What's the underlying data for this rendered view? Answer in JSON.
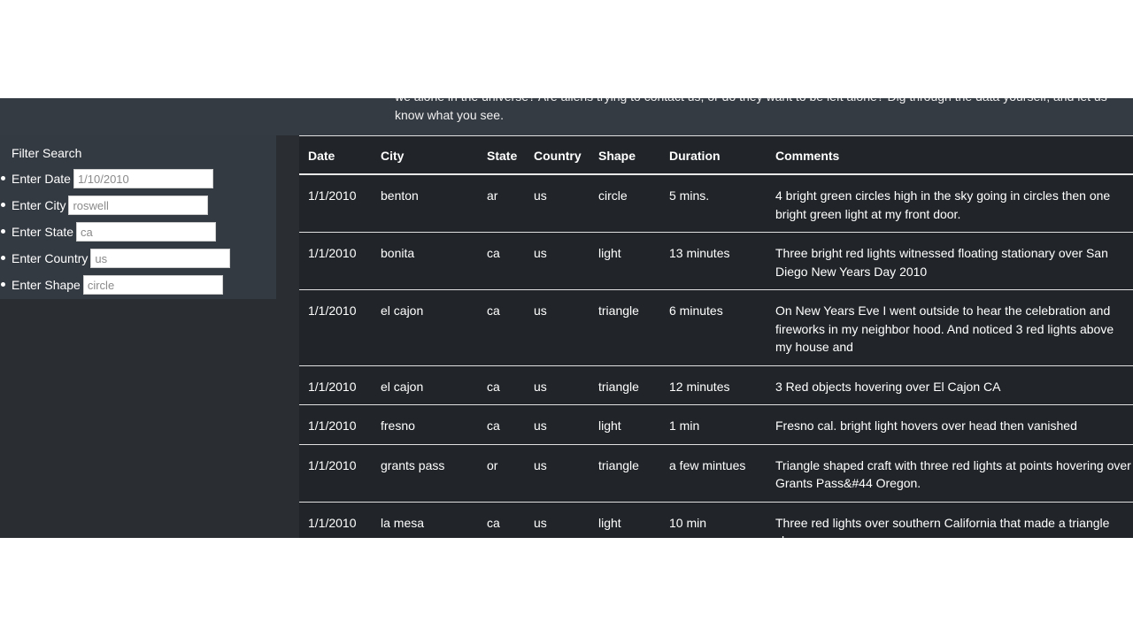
{
  "intro": {
    "text": "we alone in the universe? Are aliens trying to contact us, or do they want to be left alone? Dig through the data yourself, and let us know what you see."
  },
  "filter": {
    "title": "Filter Search",
    "fields": [
      {
        "label": "Enter Date",
        "placeholder": "1/10/2010"
      },
      {
        "label": "Enter City",
        "placeholder": "roswell"
      },
      {
        "label": "Enter State",
        "placeholder": "ca"
      },
      {
        "label": "Enter Country",
        "placeholder": "us"
      },
      {
        "label": "Enter Shape",
        "placeholder": "circle"
      }
    ]
  },
  "table": {
    "headers": [
      "Date",
      "City",
      "State",
      "Country",
      "Shape",
      "Duration",
      "Comments"
    ],
    "rows": [
      [
        "1/1/2010",
        "benton",
        "ar",
        "us",
        "circle",
        "5 mins.",
        "4 bright green circles high in the sky going in circles then one bright green light at my front door."
      ],
      [
        "1/1/2010",
        "bonita",
        "ca",
        "us",
        "light",
        "13 minutes",
        "Three bright red lights witnessed floating stationary over San Diego New Years Day 2010"
      ],
      [
        "1/1/2010",
        "el cajon",
        "ca",
        "us",
        "triangle",
        "6 minutes",
        "On New Years Eve I went outside to hear the celebration and fireworks in my neighbor hood. And noticed 3 red lights above my house and"
      ],
      [
        "1/1/2010",
        "el cajon",
        "ca",
        "us",
        "triangle",
        "12 minutes",
        "3 Red objects hovering over El Cajon CA"
      ],
      [
        "1/1/2010",
        "fresno",
        "ca",
        "us",
        "light",
        "1 min",
        "Fresno cal. bright light hovers over head then vanished"
      ],
      [
        "1/1/2010",
        "grants pass",
        "or",
        "us",
        "triangle",
        "a few mintues",
        "Triangle shaped craft with three red lights at points hovering over Grants Pass&#44 Oregon."
      ],
      [
        "1/1/2010",
        "la mesa",
        "ca",
        "us",
        "light",
        "10 min",
        "Three red lights over southern California that made a triangle shape"
      ]
    ]
  }
}
